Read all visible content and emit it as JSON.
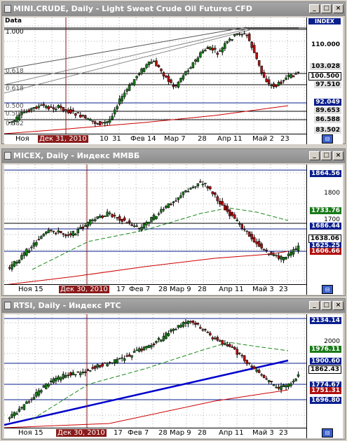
{
  "panes": [
    {
      "title": "MINI.CRUDE, Daily - Light Sweet Crude Oil Futures CFD",
      "data_label": "Data",
      "scale_header": "INDEX",
      "x_labels": [
        "Ноя",
        "Дек 31, 2010",
        "10",
        "31",
        "Фев 14",
        "Мар 7",
        "28",
        "Апр 11",
        "Май 2",
        "23"
      ],
      "y_labels": [
        {
          "text": "110.000",
          "color": "#000000",
          "bg": ""
        },
        {
          "text": "103.028",
          "color": "#000000",
          "bg": "#e0e0e0"
        },
        {
          "text": "100.500",
          "color": "#000000",
          "bg": "#ffffff"
        },
        {
          "text": "97.510",
          "color": "#000000",
          "bg": "#e0e0e0"
        },
        {
          "text": "92.049",
          "color": "#ffffff",
          "bg": "#0a1e8c"
        },
        {
          "text": "89.653",
          "color": "#000000",
          "bg": "#e0e0e0"
        },
        {
          "text": "86.588",
          "color": "#000000",
          "bg": "#e0e0e0"
        },
        {
          "text": "83.502",
          "color": "#000000",
          "bg": "#e0e0e0"
        }
      ],
      "fib_labels": [
        "1.000",
        "0.618",
        "0.618",
        "0.500",
        "0.500",
        "0.382"
      ]
    },
    {
      "title": "MICEX, Daily - Индекс ММВБ",
      "data_label": "",
      "scale_header": "",
      "x_labels": [
        "Ноя 15",
        "Дек 30, 2010",
        "17",
        "Фев 7",
        "28",
        "Мар 9",
        "28",
        "Апр 11",
        "Май 3",
        "23"
      ],
      "y_labels": [
        {
          "text": "1864.56",
          "color": "#ffffff",
          "bg": "#0a1e8c"
        },
        {
          "text": "1800",
          "color": "#000000",
          "bg": ""
        },
        {
          "text": "1733.76",
          "color": "#ffffff",
          "bg": "#1a7a1a"
        },
        {
          "text": "1700",
          "color": "#000000",
          "bg": ""
        },
        {
          "text": "1686.44",
          "color": "#ffffff",
          "bg": "#0a1e8c"
        },
        {
          "text": "1638.06",
          "color": "#000000",
          "bg": "#ffffff"
        },
        {
          "text": "1625.25",
          "color": "#ffffff",
          "bg": "#0a1e8c"
        },
        {
          "text": "1606.66",
          "color": "#ffffff",
          "bg": "#b01010"
        }
      ],
      "fib_labels": []
    },
    {
      "title": "RTSI, Daily - Индекс РТС",
      "data_label": "",
      "scale_header": "",
      "x_labels": [
        "Ноя 15",
        "Дек 30, 2010",
        "17",
        "Фев 7",
        "28",
        "Мар 9",
        "28",
        "Апр 11",
        "Май 3",
        "23"
      ],
      "y_labels": [
        {
          "text": "2134.14",
          "color": "#ffffff",
          "bg": "#0a1e8c"
        },
        {
          "text": "2000",
          "color": "#000000",
          "bg": ""
        },
        {
          "text": "1976.11",
          "color": "#ffffff",
          "bg": "#1a7a1a"
        },
        {
          "text": "1900.60",
          "color": "#ffffff",
          "bg": "#0a1e8c"
        },
        {
          "text": "1862.43",
          "color": "#000000",
          "bg": "#ffffff"
        },
        {
          "text": "1774.67",
          "color": "#ffffff",
          "bg": "#0a1e8c"
        },
        {
          "text": "1751.31",
          "color": "#ffffff",
          "bg": "#b01010"
        },
        {
          "text": "1696.80",
          "color": "#ffffff",
          "bg": "#0a1e8c"
        }
      ],
      "fib_labels": []
    }
  ],
  "window_buttons": {
    "minimize": "_",
    "maximize": "□",
    "close": "×"
  },
  "colors": {
    "up": "#1a7a1a",
    "down": "#b01010",
    "trend": "#0000cc",
    "ma_long": "#cc0000",
    "ma_short": "#1a8a1a",
    "cursor": "#8b1a1a"
  }
}
